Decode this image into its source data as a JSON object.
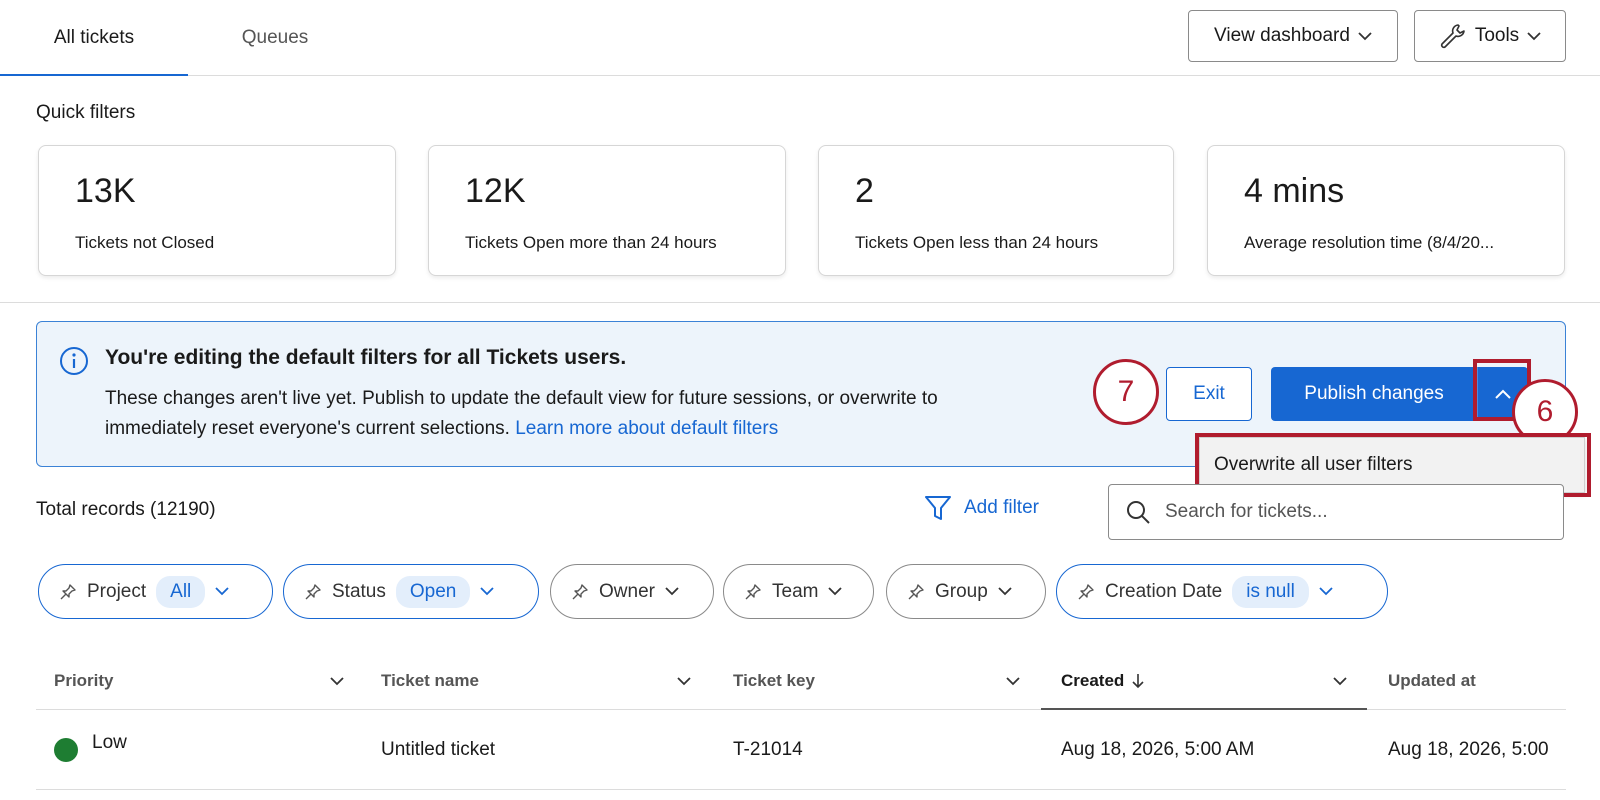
{
  "tabs": [
    {
      "label": "All tickets",
      "active": true
    },
    {
      "label": "Queues",
      "active": false
    }
  ],
  "toolbar": {
    "view_dashboard_label": "View dashboard",
    "tools_label": "Tools"
  },
  "quick_filters": {
    "title": "Quick filters",
    "cards": [
      {
        "value": "13K",
        "label": "Tickets not Closed"
      },
      {
        "value": "12K",
        "label": "Tickets Open more than 24 hours"
      },
      {
        "value": "2",
        "label": "Tickets Open less than 24 hours"
      },
      {
        "value": "4 mins",
        "label": "Average resolution time (8/4/20..."
      }
    ]
  },
  "banner": {
    "title": "You're editing the default filters for all Tickets users.",
    "text_line1": "These changes aren't live yet. Publish to update the default view for future sessions, or overwrite to",
    "text_line2": "immediately reset everyone's current selections.",
    "link": "Learn more about default filters",
    "exit_label": "Exit",
    "publish_label": "Publish changes",
    "dropdown_item": "Overwrite all user filters"
  },
  "annotations": {
    "step_7": "7",
    "step_6": "6",
    "highlight_color": "#b01c2e"
  },
  "records": {
    "total_label": "Total records (12190)",
    "add_filter_label": "Add filter",
    "search_placeholder": "Search for tickets..."
  },
  "filter_pills": [
    {
      "label": "Project",
      "value": "All"
    },
    {
      "label": "Status",
      "value": "Open"
    },
    {
      "label": "Owner",
      "value": ""
    },
    {
      "label": "Team",
      "value": ""
    },
    {
      "label": "Group",
      "value": ""
    },
    {
      "label": "Creation Date",
      "value": "is null"
    }
  ],
  "table": {
    "columns": [
      "Priority",
      "Ticket name",
      "Ticket key",
      "Created",
      "Updated at"
    ],
    "sorted_column": "Created",
    "rows": [
      {
        "priority": "Low",
        "priority_color": "#1e7d32",
        "name": "Untitled ticket",
        "key": "T-21014",
        "created": "Aug 18, 2026, 5:00 AM",
        "updated": "Aug 18, 2026, 5:00"
      }
    ]
  },
  "colors": {
    "accent": "#1767d2",
    "banner_bg": "#edf4fb"
  }
}
